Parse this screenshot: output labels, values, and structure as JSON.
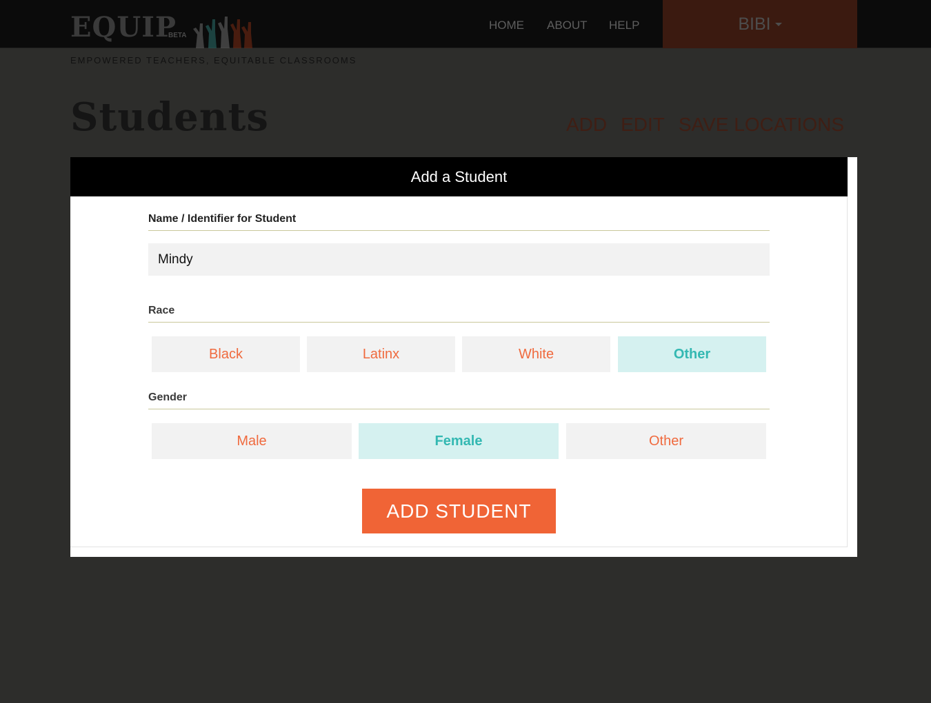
{
  "header": {
    "logo": "EQUIP",
    "beta": "BETA",
    "tagline": "EMPOWERED TEACHERS, EQUITABLE CLASSROOMS",
    "nav": [
      "HOME",
      "ABOUT",
      "HELP"
    ],
    "user": "BIBI"
  },
  "page": {
    "title": "Students",
    "actions": [
      "ADD",
      "EDIT",
      "SAVE LOCATIONS"
    ]
  },
  "modal": {
    "title": "Add a Student",
    "name_label": "Name / Identifier for Student",
    "name_value": "Mindy",
    "race_label": "Race",
    "race_options": [
      "Black",
      "Latinx",
      "White",
      "Other"
    ],
    "race_selected": "Other",
    "gender_label": "Gender",
    "gender_options": [
      "Male",
      "Female",
      "Other"
    ],
    "gender_selected": "Female",
    "submit_label": "ADD STUDENT"
  },
  "colors": {
    "accent": "#f06436",
    "selected_bg": "#d5f1f0",
    "selected_text": "#33b8b2"
  }
}
